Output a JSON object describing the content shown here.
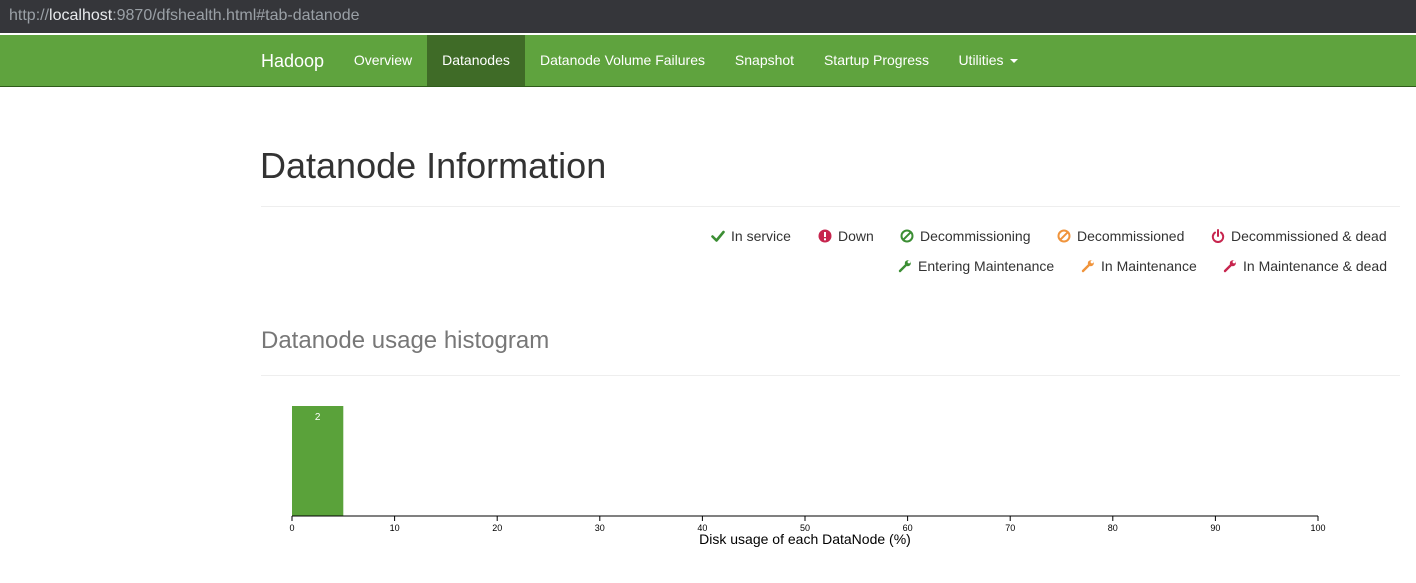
{
  "browser": {
    "url_prefix": "http://",
    "url_host": "localhost",
    "url_rest": ":9870/dfshealth.html#tab-datanode"
  },
  "navbar": {
    "brand": "Hadoop",
    "items": [
      {
        "label": "Overview",
        "active": false
      },
      {
        "label": "Datanodes",
        "active": true
      },
      {
        "label": "Datanode Volume Failures",
        "active": false
      },
      {
        "label": "Snapshot",
        "active": false
      },
      {
        "label": "Startup Progress",
        "active": false
      },
      {
        "label": "Utilities",
        "active": false,
        "dropdown": true
      }
    ]
  },
  "page": {
    "title": "Datanode Information"
  },
  "legend": [
    {
      "label": "In service",
      "icon": "check-icon",
      "color": "#3c8e34"
    },
    {
      "label": "Down",
      "icon": "exclamation-circle-icon",
      "color": "#c7254e"
    },
    {
      "label": "Decommissioning",
      "icon": "ban-icon",
      "color": "#3c8e34"
    },
    {
      "label": "Decommissioned",
      "icon": "ban-icon",
      "color": "#f0943c"
    },
    {
      "label": "Decommissioned & dead",
      "icon": "power-off-icon",
      "color": "#c7254e"
    },
    {
      "label": "Entering Maintenance",
      "icon": "wrench-icon",
      "color": "#3c8e34"
    },
    {
      "label": "In Maintenance",
      "icon": "wrench-icon",
      "color": "#f0943c"
    },
    {
      "label": "In Maintenance & dead",
      "icon": "wrench-icon",
      "color": "#c7254e"
    }
  ],
  "histogram_section": {
    "title": "Datanode usage histogram"
  },
  "colors": {
    "navbar": "#5fa33e",
    "navbar_active": "#3f6b27",
    "bar": "#5aa23a"
  },
  "chart_data": {
    "type": "bar",
    "xlabel": "Disk usage of each DataNode (%)",
    "xlim": [
      0,
      100
    ],
    "xticks": [
      0,
      10,
      20,
      30,
      40,
      50,
      60,
      70,
      80,
      90,
      100
    ],
    "bins": [
      {
        "x0": 0,
        "x1": 5,
        "count": 2
      }
    ],
    "ylim": [
      0,
      2
    ]
  }
}
